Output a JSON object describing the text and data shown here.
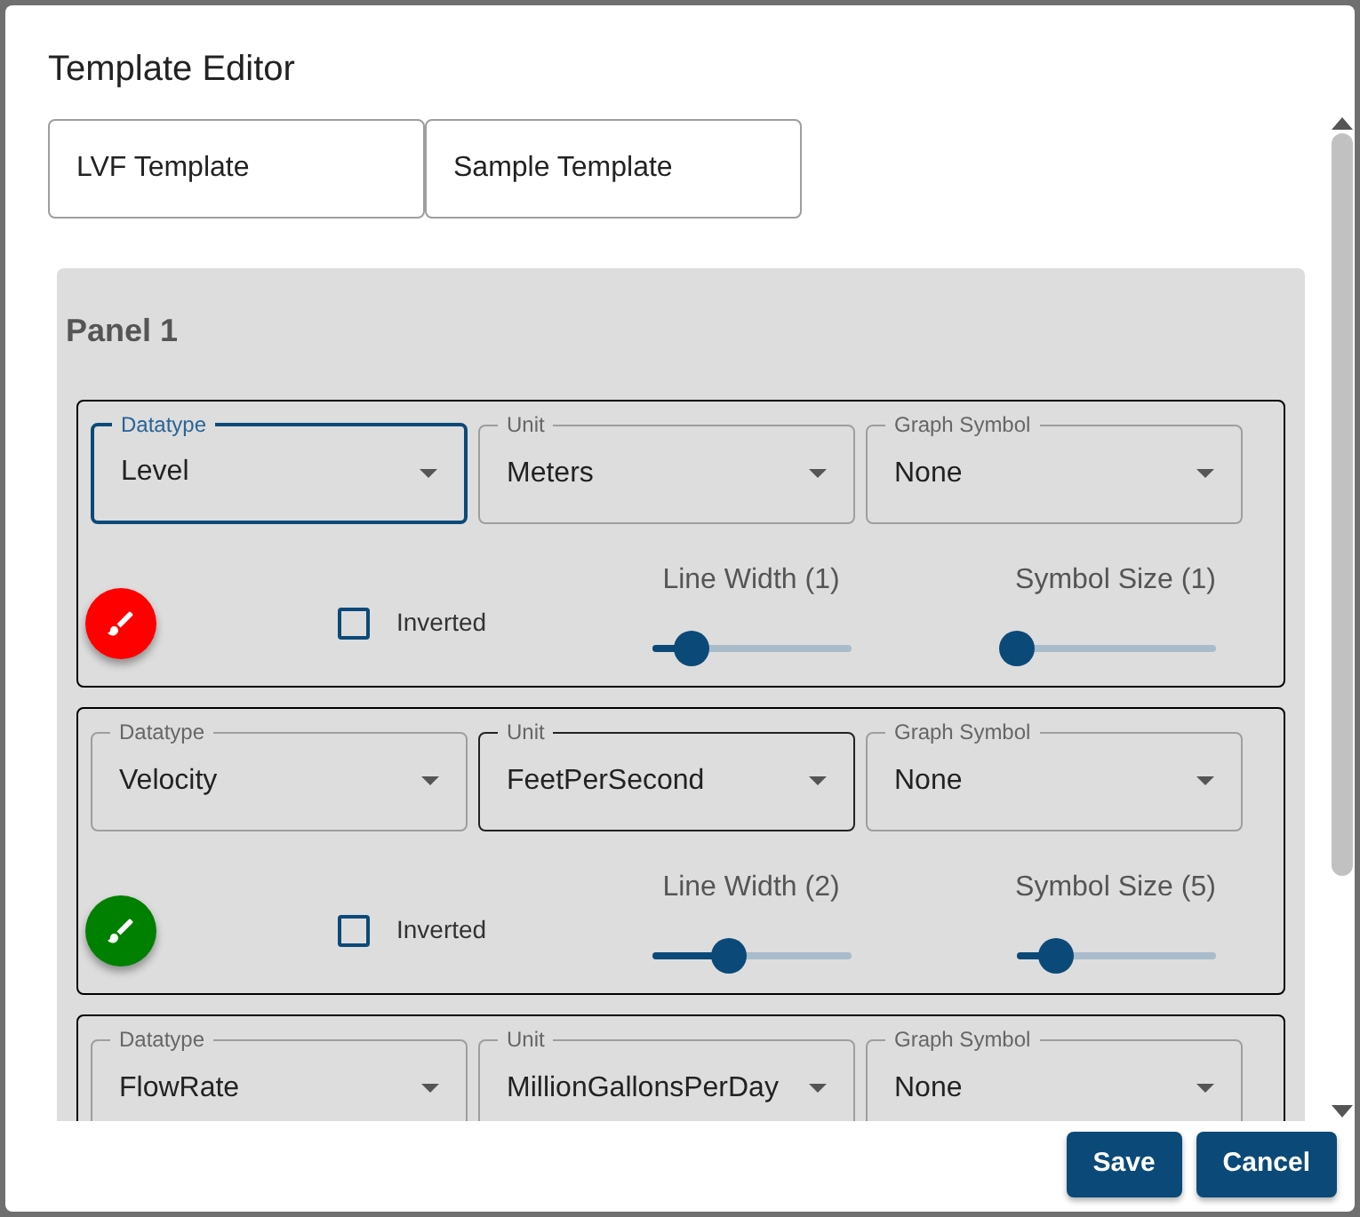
{
  "dialog": {
    "title": "Template Editor"
  },
  "templates": [
    {
      "label": "LVF Template"
    },
    {
      "label": "Sample Template"
    }
  ],
  "panel": {
    "title": "Panel 1",
    "rows": [
      {
        "selects": [
          {
            "label": "Datatype",
            "value": "Level",
            "focused": true,
            "hovered": false
          },
          {
            "label": "Unit",
            "value": "Meters",
            "focused": false,
            "hovered": false
          },
          {
            "label": "Graph Symbol",
            "value": "None",
            "focused": false,
            "hovered": false
          }
        ],
        "color": "#ff0000",
        "inverted": {
          "label": "Inverted",
          "checked": false
        },
        "sliders": [
          {
            "label": "Line Width (1)",
            "level": 0.2
          },
          {
            "label": "Symbol Size (1)",
            "level": 0
          }
        ]
      },
      {
        "selects": [
          {
            "label": "Datatype",
            "value": "Velocity",
            "focused": false,
            "hovered": false
          },
          {
            "label": "Unit",
            "value": "FeetPerSecond",
            "focused": false,
            "hovered": true
          },
          {
            "label": "Graph Symbol",
            "value": "None",
            "focused": false,
            "hovered": false
          }
        ],
        "color": "#008000",
        "inverted": {
          "label": "Inverted",
          "checked": false
        },
        "sliders": [
          {
            "label": "Line Width (2)",
            "level": 0.39
          },
          {
            "label": "Symbol Size (5)",
            "level": 0.2
          }
        ]
      },
      {
        "selects": [
          {
            "label": "Datatype",
            "value": "FlowRate",
            "focused": false,
            "hovered": false
          },
          {
            "label": "Unit",
            "value": "MillionGallonsPerDay",
            "focused": false,
            "hovered": false
          },
          {
            "label": "Graph Symbol",
            "value": "None",
            "focused": false,
            "hovered": false
          }
        ]
      }
    ]
  },
  "buttons": [
    {
      "label": "Save"
    },
    {
      "label": "Cancel"
    }
  ]
}
